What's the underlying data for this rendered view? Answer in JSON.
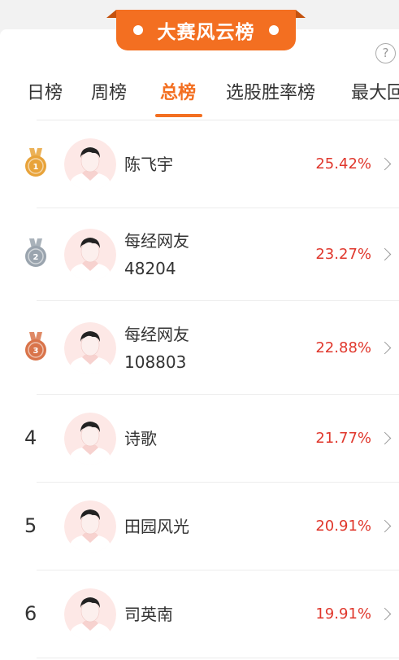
{
  "banner": {
    "title": "大赛风云榜"
  },
  "tabs": [
    {
      "label": "日榜",
      "active": false
    },
    {
      "label": "周榜",
      "active": false
    },
    {
      "label": "总榜",
      "active": true
    },
    {
      "label": "选股胜率榜",
      "active": false
    },
    {
      "label": "最大回",
      "active": false
    }
  ],
  "help_label": "?",
  "rankings": [
    {
      "rank": "1",
      "medal": "gold",
      "name_lines": [
        "陈飞宇"
      ],
      "rate": "25.42%"
    },
    {
      "rank": "2",
      "medal": "silver",
      "name_lines": [
        "每经网友",
        "48204"
      ],
      "rate": "23.27%"
    },
    {
      "rank": "3",
      "medal": "bronze",
      "name_lines": [
        "每经网友",
        "108803"
      ],
      "rate": "22.88%"
    },
    {
      "rank": "4",
      "medal": null,
      "name_lines": [
        "诗歌"
      ],
      "rate": "21.77%"
    },
    {
      "rank": "5",
      "medal": null,
      "name_lines": [
        "田园风光"
      ],
      "rate": "20.91%"
    },
    {
      "rank": "6",
      "medal": null,
      "name_lines": [
        "司英南"
      ],
      "rate": "19.91%"
    }
  ],
  "colors": {
    "accent": "#f36f21",
    "rate": "#e0372c",
    "gold": "#e8a33a",
    "silver": "#9aa4ae",
    "bronze": "#d9744a"
  }
}
